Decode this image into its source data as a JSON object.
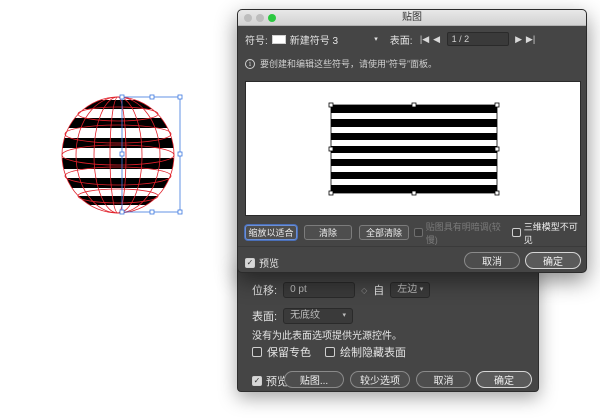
{
  "window": {
    "title": "贴图"
  },
  "toolbar": {
    "symbol_label": "符号:",
    "symbol_value": "新建符号 3",
    "surface_label": "表面:",
    "page_value": "1 / 2"
  },
  "info": {
    "text": "要创建和编辑这些符号，请使用“符号”面板。"
  },
  "buttons": {
    "fit": "缩放以适合",
    "clear": "清除",
    "clear_all": "全部清除",
    "shade_artwork": "贴图具有明暗调(较慢)",
    "invisible_geometry": "三维模型不可见",
    "preview": "预览",
    "cancel": "取消",
    "ok": "确定"
  },
  "back_dialog": {
    "position_label": "位移:",
    "position_value": "0 pt",
    "from_label": "自",
    "from_value": "左边",
    "surface_label": "表面:",
    "surface_value": "无底纹",
    "note": "没有为此表面选项提供光源控件。",
    "preserve_spot": "保留专色",
    "draw_hidden": "绘制隐藏表面",
    "preview": "预览",
    "map_art": "贴图...",
    "fewer_options": "较少选项",
    "cancel": "取消",
    "ok": "确定"
  },
  "colors": {
    "dialog_bg": "#454545",
    "wireframe": "#e0202a",
    "selection": "#3c78e0"
  },
  "icons": [
    "symbol-swatch-icon",
    "dropdown-chevron-icon",
    "first-page-icon",
    "prev-page-icon",
    "next-page-icon",
    "last-page-icon",
    "info-icon",
    "checkbox-icon"
  ]
}
